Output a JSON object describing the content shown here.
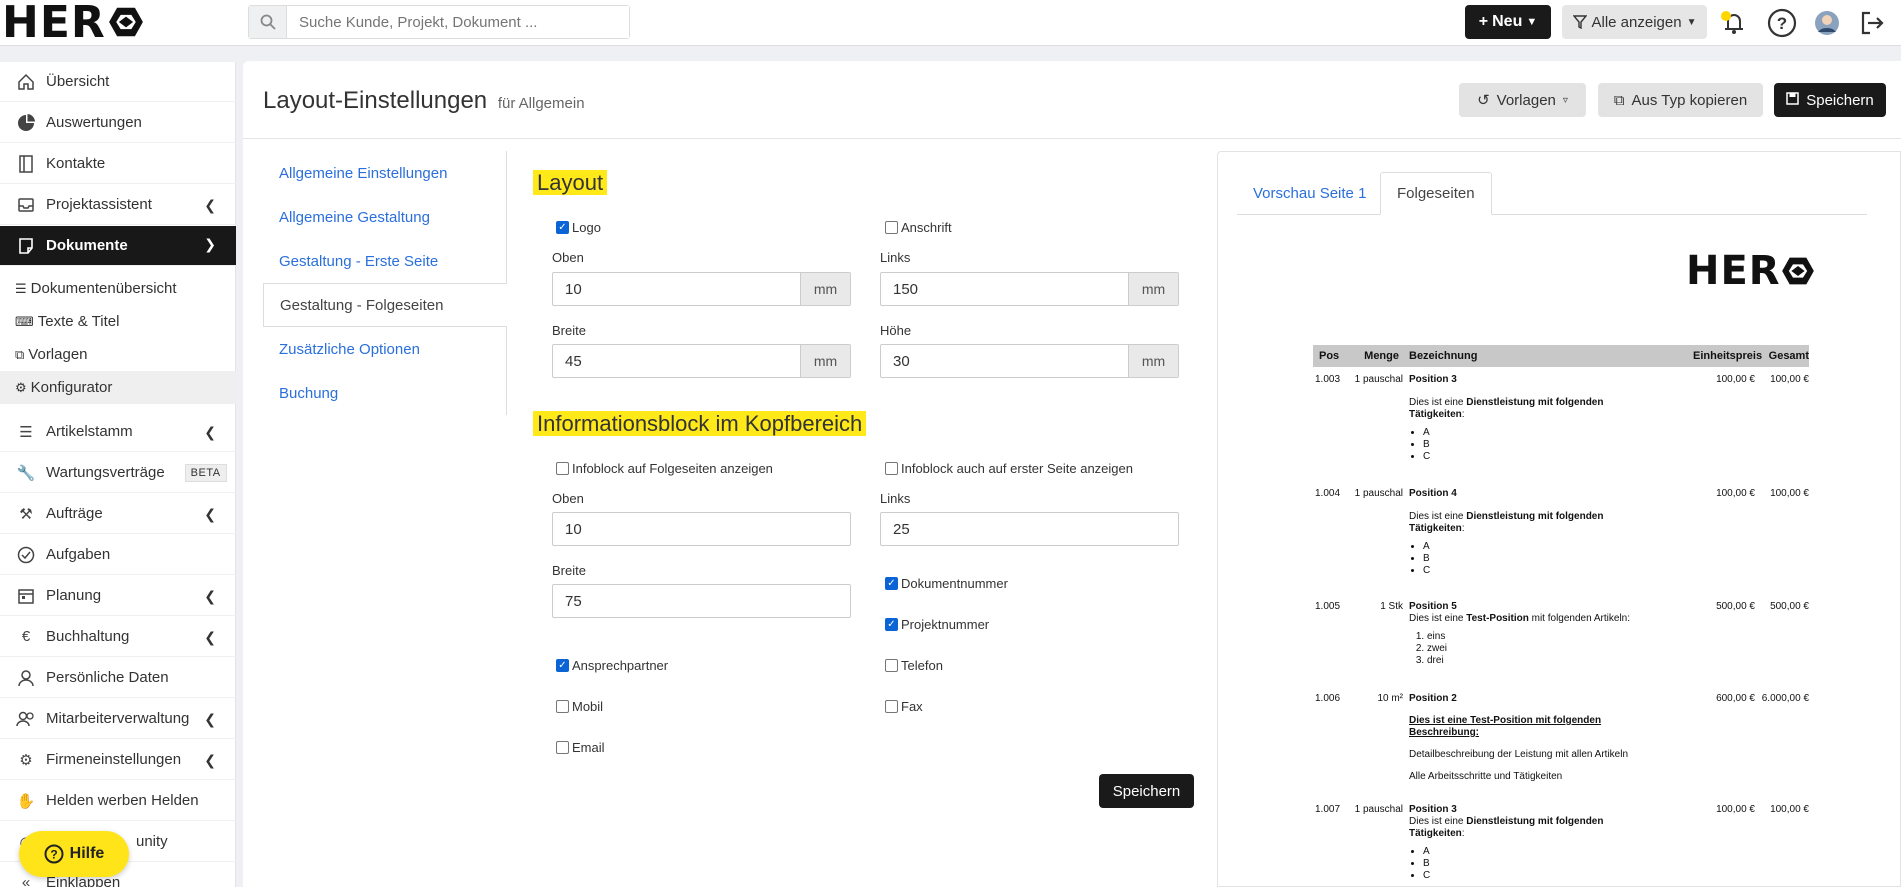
{
  "topbar": {
    "logo_text": "HER",
    "search_placeholder": "Suche Kunde, Projekt, Dokument ...",
    "new_label": "Neu",
    "filter_label": "Alle anzeigen"
  },
  "sidebar": {
    "items": [
      {
        "label": "Übersicht",
        "icon": "home-icon"
      },
      {
        "label": "Auswertungen",
        "icon": "pie-chart-icon"
      },
      {
        "label": "Kontakte",
        "icon": "address-book-icon"
      },
      {
        "label": "Projektassistent",
        "icon": "inbox-icon"
      },
      {
        "label": "Dokumente",
        "icon": "document-icon"
      }
    ],
    "sub_items": [
      "Dokumentenübersicht",
      "Texte & Titel",
      "Vorlagen",
      "Konfigurator"
    ],
    "items2": [
      {
        "label": "Artikelstamm",
        "icon": "list-icon"
      },
      {
        "label": "Wartungsverträge",
        "icon": "wrench-icon",
        "badge": "BETA"
      },
      {
        "label": "Aufträge",
        "icon": "tools-icon"
      },
      {
        "label": "Aufgaben",
        "icon": "check-circle-icon"
      },
      {
        "label": "Planung",
        "icon": "calendar-icon"
      },
      {
        "label": "Buchhaltung",
        "icon": "euro-icon"
      },
      {
        "label": "Persönliche Daten",
        "icon": "user-icon"
      },
      {
        "label": "Mitarbeiterverwaltung",
        "icon": "users-icon"
      },
      {
        "label": "Firmeneinstellungen",
        "icon": "gear-icon"
      },
      {
        "label": "Helden werben Helden",
        "icon": "handshake-icon"
      },
      {
        "label": "unity",
        "icon": "community-icon"
      },
      {
        "label": "Einklappen",
        "icon": "collapse-icon"
      }
    ],
    "help_label": "Hilfe"
  },
  "header": {
    "title": "Layout-Einstellungen",
    "subtitle": "für Allgemein",
    "vorlagen_label": "Vorlagen",
    "copy_label": "Aus Typ kopieren",
    "save_label": "Speichern"
  },
  "settings_nav": [
    "Allgemeine Einstellungen",
    "Allgemeine Gestaltung",
    "Gestaltung - Erste Seite",
    "Gestaltung - Folgeseiten",
    "Zusätzliche Optionen",
    "Buchung"
  ],
  "form": {
    "layout_title": "Layout",
    "logo_label": "Logo",
    "logo_checked": true,
    "anschrift_label": "Anschrift",
    "anschrift_checked": false,
    "oben_label": "Oben",
    "oben_value": "10",
    "links_label": "Links",
    "links_value": "150",
    "breite_label": "Breite",
    "breite_value": "45",
    "hoehe_label": "Höhe",
    "hoehe_value": "30",
    "unit": "mm",
    "info_title": "Informationsblock im Kopfbereich",
    "info_folge_label": "Infoblock auf Folgeseiten anzeigen",
    "info_erste_label": "Infoblock auch auf erster Seite anzeigen",
    "info_oben_label": "Oben",
    "info_oben_value": "10",
    "info_links_label": "Links",
    "info_links_value": "25",
    "info_breite_label": "Breite",
    "info_breite_value": "75",
    "dokumentnummer_label": "Dokumentnummer",
    "projektnummer_label": "Projektnummer",
    "ansprechpartner_label": "Ansprechpartner",
    "telefon_label": "Telefon",
    "mobil_label": "Mobil",
    "fax_label": "Fax",
    "email_label": "Email",
    "save_label": "Speichern"
  },
  "preview": {
    "tab1": "Vorschau Seite 1",
    "tab2": "Folgeseiten",
    "logo_text": "HER",
    "head": {
      "pos": "Pos",
      "menge": "Menge",
      "bez": "Bezeichnung",
      "ep": "Einheitspreis",
      "ges": "Gesamt"
    },
    "rows": [
      {
        "pos": "1.003",
        "menge": "1 pauschal",
        "title": "Position 3",
        "ep": "100,00 €",
        "ges": "100,00 €"
      },
      {
        "pos": "1.004",
        "menge": "1 pauschal",
        "title": "Position 4",
        "ep": "100,00 €",
        "ges": "100,00 €"
      },
      {
        "pos": "1.005",
        "menge": "1 Stk",
        "title": "Position 5",
        "ep": "500,00 €",
        "ges": "500,00 €"
      },
      {
        "pos": "1.006",
        "menge": "10 m²",
        "title": "Position 2",
        "ep": "600,00 €",
        "ges": "6.000,00 €"
      },
      {
        "pos": "1.007",
        "menge": "1 pauschal",
        "title": "Position 3",
        "ep": "100,00 €",
        "ges": "100,00 €"
      }
    ],
    "txt_dienst_pre": "Dies ist eine",
    "txt_dienst_bold": "Dienstleistung mit folgenden Tätigkeiten",
    "txt_test_pre": "Dies ist eine",
    "txt_test_bold": "Test-Position",
    "txt_test_post": "mit folgenden Artikeln:",
    "list_abc": [
      "A",
      "B",
      "C"
    ],
    "list_num": [
      "eins",
      "zwei",
      "drei"
    ],
    "txt_beschr": "Dies ist eine Test-Position mit folgenden Beschreibung:",
    "txt_detail": "Detailbeschreibung der Leistung mit allen Artikeln",
    "txt_alle": "Alle Arbeitsschritte und Tätigkeiten"
  }
}
